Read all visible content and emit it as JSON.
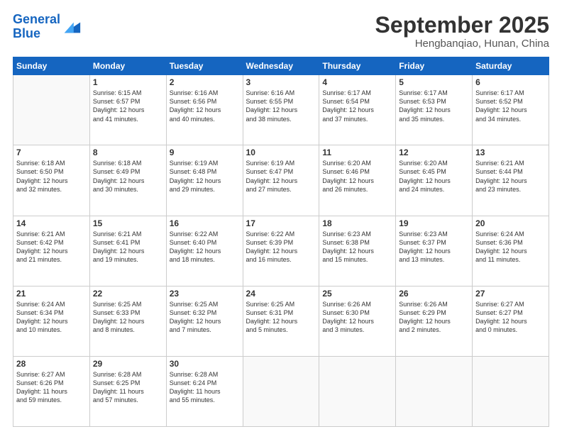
{
  "header": {
    "logo_line1": "General",
    "logo_line2": "Blue",
    "month": "September 2025",
    "location": "Hengbanqiao, Hunan, China"
  },
  "days_of_week": [
    "Sunday",
    "Monday",
    "Tuesday",
    "Wednesday",
    "Thursday",
    "Friday",
    "Saturday"
  ],
  "weeks": [
    [
      {
        "day": "",
        "info": ""
      },
      {
        "day": "1",
        "info": "Sunrise: 6:15 AM\nSunset: 6:57 PM\nDaylight: 12 hours\nand 41 minutes."
      },
      {
        "day": "2",
        "info": "Sunrise: 6:16 AM\nSunset: 6:56 PM\nDaylight: 12 hours\nand 40 minutes."
      },
      {
        "day": "3",
        "info": "Sunrise: 6:16 AM\nSunset: 6:55 PM\nDaylight: 12 hours\nand 38 minutes."
      },
      {
        "day": "4",
        "info": "Sunrise: 6:17 AM\nSunset: 6:54 PM\nDaylight: 12 hours\nand 37 minutes."
      },
      {
        "day": "5",
        "info": "Sunrise: 6:17 AM\nSunset: 6:53 PM\nDaylight: 12 hours\nand 35 minutes."
      },
      {
        "day": "6",
        "info": "Sunrise: 6:17 AM\nSunset: 6:52 PM\nDaylight: 12 hours\nand 34 minutes."
      }
    ],
    [
      {
        "day": "7",
        "info": "Sunrise: 6:18 AM\nSunset: 6:50 PM\nDaylight: 12 hours\nand 32 minutes."
      },
      {
        "day": "8",
        "info": "Sunrise: 6:18 AM\nSunset: 6:49 PM\nDaylight: 12 hours\nand 30 minutes."
      },
      {
        "day": "9",
        "info": "Sunrise: 6:19 AM\nSunset: 6:48 PM\nDaylight: 12 hours\nand 29 minutes."
      },
      {
        "day": "10",
        "info": "Sunrise: 6:19 AM\nSunset: 6:47 PM\nDaylight: 12 hours\nand 27 minutes."
      },
      {
        "day": "11",
        "info": "Sunrise: 6:20 AM\nSunset: 6:46 PM\nDaylight: 12 hours\nand 26 minutes."
      },
      {
        "day": "12",
        "info": "Sunrise: 6:20 AM\nSunset: 6:45 PM\nDaylight: 12 hours\nand 24 minutes."
      },
      {
        "day": "13",
        "info": "Sunrise: 6:21 AM\nSunset: 6:44 PM\nDaylight: 12 hours\nand 23 minutes."
      }
    ],
    [
      {
        "day": "14",
        "info": "Sunrise: 6:21 AM\nSunset: 6:42 PM\nDaylight: 12 hours\nand 21 minutes."
      },
      {
        "day": "15",
        "info": "Sunrise: 6:21 AM\nSunset: 6:41 PM\nDaylight: 12 hours\nand 19 minutes."
      },
      {
        "day": "16",
        "info": "Sunrise: 6:22 AM\nSunset: 6:40 PM\nDaylight: 12 hours\nand 18 minutes."
      },
      {
        "day": "17",
        "info": "Sunrise: 6:22 AM\nSunset: 6:39 PM\nDaylight: 12 hours\nand 16 minutes."
      },
      {
        "day": "18",
        "info": "Sunrise: 6:23 AM\nSunset: 6:38 PM\nDaylight: 12 hours\nand 15 minutes."
      },
      {
        "day": "19",
        "info": "Sunrise: 6:23 AM\nSunset: 6:37 PM\nDaylight: 12 hours\nand 13 minutes."
      },
      {
        "day": "20",
        "info": "Sunrise: 6:24 AM\nSunset: 6:36 PM\nDaylight: 12 hours\nand 11 minutes."
      }
    ],
    [
      {
        "day": "21",
        "info": "Sunrise: 6:24 AM\nSunset: 6:34 PM\nDaylight: 12 hours\nand 10 minutes."
      },
      {
        "day": "22",
        "info": "Sunrise: 6:25 AM\nSunset: 6:33 PM\nDaylight: 12 hours\nand 8 minutes."
      },
      {
        "day": "23",
        "info": "Sunrise: 6:25 AM\nSunset: 6:32 PM\nDaylight: 12 hours\nand 7 minutes."
      },
      {
        "day": "24",
        "info": "Sunrise: 6:25 AM\nSunset: 6:31 PM\nDaylight: 12 hours\nand 5 minutes."
      },
      {
        "day": "25",
        "info": "Sunrise: 6:26 AM\nSunset: 6:30 PM\nDaylight: 12 hours\nand 3 minutes."
      },
      {
        "day": "26",
        "info": "Sunrise: 6:26 AM\nSunset: 6:29 PM\nDaylight: 12 hours\nand 2 minutes."
      },
      {
        "day": "27",
        "info": "Sunrise: 6:27 AM\nSunset: 6:27 PM\nDaylight: 12 hours\nand 0 minutes."
      }
    ],
    [
      {
        "day": "28",
        "info": "Sunrise: 6:27 AM\nSunset: 6:26 PM\nDaylight: 11 hours\nand 59 minutes."
      },
      {
        "day": "29",
        "info": "Sunrise: 6:28 AM\nSunset: 6:25 PM\nDaylight: 11 hours\nand 57 minutes."
      },
      {
        "day": "30",
        "info": "Sunrise: 6:28 AM\nSunset: 6:24 PM\nDaylight: 11 hours\nand 55 minutes."
      },
      {
        "day": "",
        "info": ""
      },
      {
        "day": "",
        "info": ""
      },
      {
        "day": "",
        "info": ""
      },
      {
        "day": "",
        "info": ""
      }
    ]
  ]
}
